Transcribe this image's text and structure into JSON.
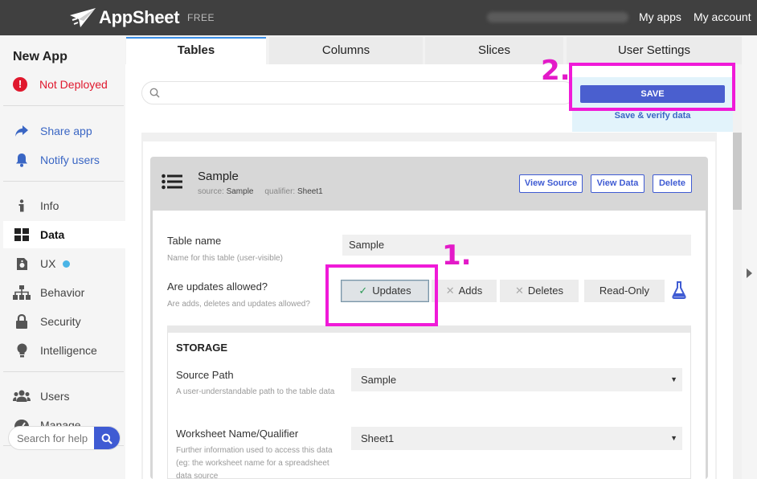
{
  "header": {
    "brand": "AppSheet",
    "plan": "FREE",
    "links": [
      "My apps",
      "My account"
    ]
  },
  "sidebar": {
    "app_name": "New App",
    "deploy_status": "Not Deployed",
    "links": [
      {
        "label": "Share app",
        "icon": "share-icon"
      },
      {
        "label": "Notify users",
        "icon": "bell-icon"
      }
    ],
    "items": [
      {
        "label": "Info",
        "icon": "info-icon"
      },
      {
        "label": "Data",
        "icon": "grid-icon",
        "active": true
      },
      {
        "label": "UX",
        "icon": "ux-icon",
        "badge": true
      },
      {
        "label": "Behavior",
        "icon": "hierarchy-icon"
      },
      {
        "label": "Security",
        "icon": "lock-icon"
      },
      {
        "label": "Intelligence",
        "icon": "bulb-icon"
      }
    ],
    "bottom_items": [
      {
        "label": "Users",
        "icon": "users-icon"
      },
      {
        "label": "Manage",
        "icon": "dashboard-icon"
      }
    ],
    "help_placeholder": "Search for help"
  },
  "tabs": [
    {
      "label": "Tables",
      "active": true
    },
    {
      "label": "Columns"
    },
    {
      "label": "Slices"
    },
    {
      "label": "User Settings"
    }
  ],
  "save": {
    "button": "SAVE",
    "verify": "Save & verify data"
  },
  "table_card": {
    "title": "Sample",
    "source_label": "source:",
    "source_value": "Sample",
    "qualifier_label": "qualifier:",
    "qualifier_value": "Sheet1",
    "buttons": [
      "View Source",
      "View Data",
      "Delete"
    ]
  },
  "fields": {
    "table_name": {
      "label": "Table name",
      "help": "Name for this table (user-visible)",
      "value": "Sample"
    },
    "updates": {
      "label": "Are updates allowed?",
      "help": "Are adds, deletes and updates allowed?",
      "options": [
        "Updates",
        "Adds",
        "Deletes",
        "Read-Only"
      ],
      "selected": "Updates"
    }
  },
  "storage": {
    "title": "STORAGE",
    "source_path": {
      "label": "Source Path",
      "help": "A user-understandable path to the table data",
      "value": "Sample"
    },
    "worksheet": {
      "label": "Worksheet Name/Qualifier",
      "help": "Further information used to access this data (eg: the worksheet name for a spreadsheet data source",
      "value": "Sheet1"
    }
  },
  "annotations": [
    "1.",
    "2."
  ],
  "colors": {
    "accent": "#3f5bd3",
    "highlight": "#f01ad8",
    "error": "#e0182d",
    "topbar": "#404040"
  }
}
